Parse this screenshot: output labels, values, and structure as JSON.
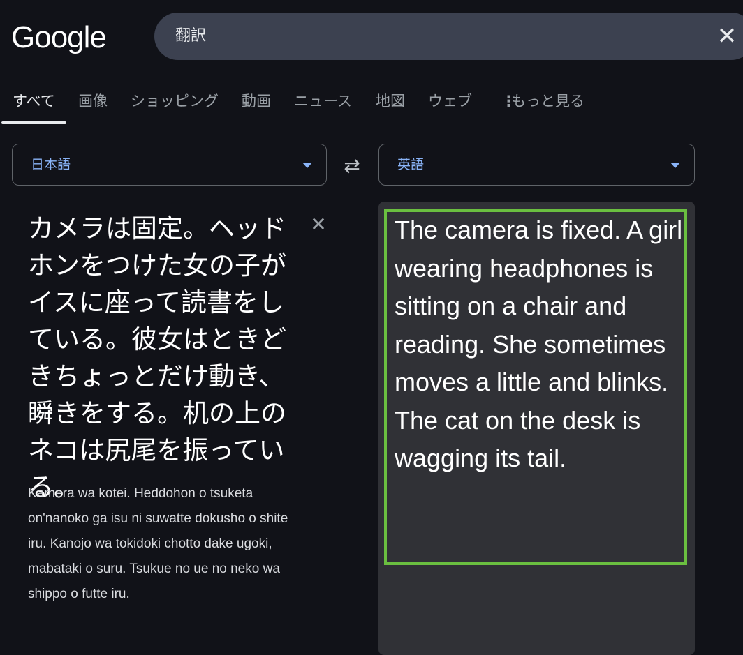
{
  "logo": "Google",
  "search": {
    "query": "翻訳"
  },
  "tabs": [
    {
      "label": "すべて"
    },
    {
      "label": "画像"
    },
    {
      "label": "ショッピング"
    },
    {
      "label": "動画"
    },
    {
      "label": "ニュース"
    },
    {
      "label": "地図"
    },
    {
      "label": "ウェブ"
    },
    {
      "label": "もっと見る"
    }
  ],
  "translator": {
    "source_lang": "日本語",
    "target_lang": "英語",
    "source_text": "カメラは固定。ヘッドホンをつけた女の子がイスに座って読書をしている。彼女はときどきちょっとだけ動き、瞬きをする。机の上のネコは尻尾を振っている。",
    "romanization": "Kamera wa kotei. Heddohon o tsuketa on'nanoko ga isu ni suwatte dokusho o shite iru. Kanojo wa tokidoki chotto dake ugoki, mabataki o suru. Tsukue no ue no neko wa shippo o futte iru.",
    "translation": "The camera is fixed. A girl wearing headphones is sitting on a chair and reading. She sometimes moves a little and blinks. The cat on the desk is wagging its tail."
  },
  "colors": {
    "background": "#111218",
    "search_bg": "#3c4150",
    "accent": "#8ab4f8",
    "highlight": "#6abf40",
    "target_panel": "#303136"
  },
  "icons": {
    "clear": "close-icon",
    "swap": "swap-icon",
    "caret": "caret-down-icon",
    "more": "more-vert-icon"
  }
}
